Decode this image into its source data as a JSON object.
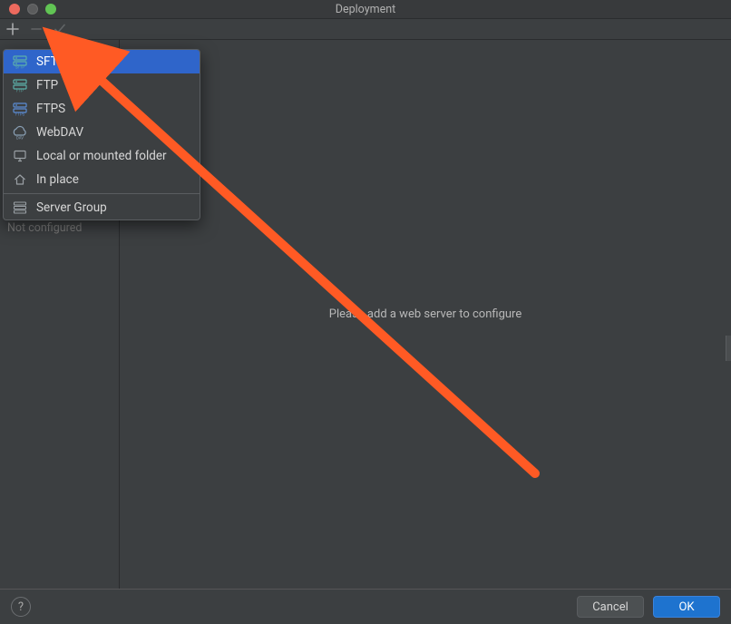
{
  "window": {
    "title": "Deployment"
  },
  "toolbar": {
    "add_tooltip": "Add",
    "remove_tooltip": "Remove",
    "check_tooltip": "Set as default"
  },
  "sidebar": {
    "empty_text": "Not configured"
  },
  "main": {
    "prompt": "Please add a web server to configure"
  },
  "footer": {
    "cancel": "Cancel",
    "ok": "OK"
  },
  "menu": {
    "selected_index": 0,
    "items": [
      {
        "label": "SFTP",
        "icon": "server-sftp-icon"
      },
      {
        "label": "FTP",
        "icon": "server-ftp-icon"
      },
      {
        "label": "FTPS",
        "icon": "server-ftps-icon"
      },
      {
        "label": "WebDAV",
        "icon": "webdav-icon"
      },
      {
        "label": "Local or mounted folder",
        "icon": "monitor-icon"
      },
      {
        "label": "In place",
        "icon": "home-icon"
      }
    ],
    "group": {
      "label": "Server Group",
      "icon": "server-group-icon"
    }
  },
  "accent": {
    "arrow_color": "#ff5a24"
  }
}
